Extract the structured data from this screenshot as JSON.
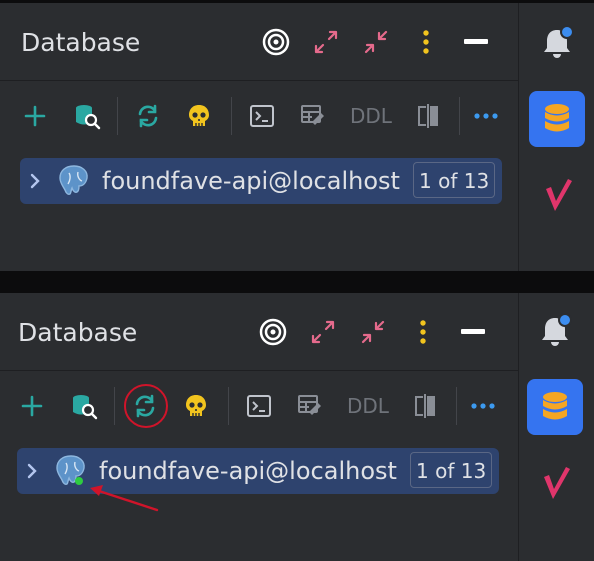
{
  "panels": [
    {
      "title": "Database",
      "tree_row": {
        "label": "foundfave-api@localhost",
        "count": "1 of 13"
      }
    },
    {
      "title": "Database",
      "tree_row": {
        "label": "foundfave-api@localhost",
        "count": "1 of 13"
      }
    }
  ],
  "toolbar": {
    "ddl_label": "DDL"
  },
  "icons": {
    "header": [
      "target-icon",
      "expand-icon",
      "collapse-icon",
      "more-vertical-icon",
      "minimize-icon"
    ],
    "toolbar": [
      "add-icon",
      "data-source-properties-icon",
      "refresh-icon",
      "skull-icon",
      "console-icon",
      "table-edit-icon",
      "ddl-icon",
      "compare-icon",
      "more-horizontal-icon"
    ],
    "strip": [
      "notifications-icon",
      "database-icon",
      "check-v-icon"
    ]
  },
  "colors": {
    "panel_bg": "#2b2d30",
    "row_highlight": "#2e436e",
    "accent_blue": "#3574f0",
    "icon_teal": "#2aa8a2",
    "icon_yellow": "#f2c41e",
    "icon_pink": "#e56a8c",
    "annotation_red": "#d0142a",
    "status_green": "#2ecc40"
  },
  "annotations": {
    "highlighted_element": "refresh-icon",
    "arrow_target": "connection-status-dot"
  }
}
